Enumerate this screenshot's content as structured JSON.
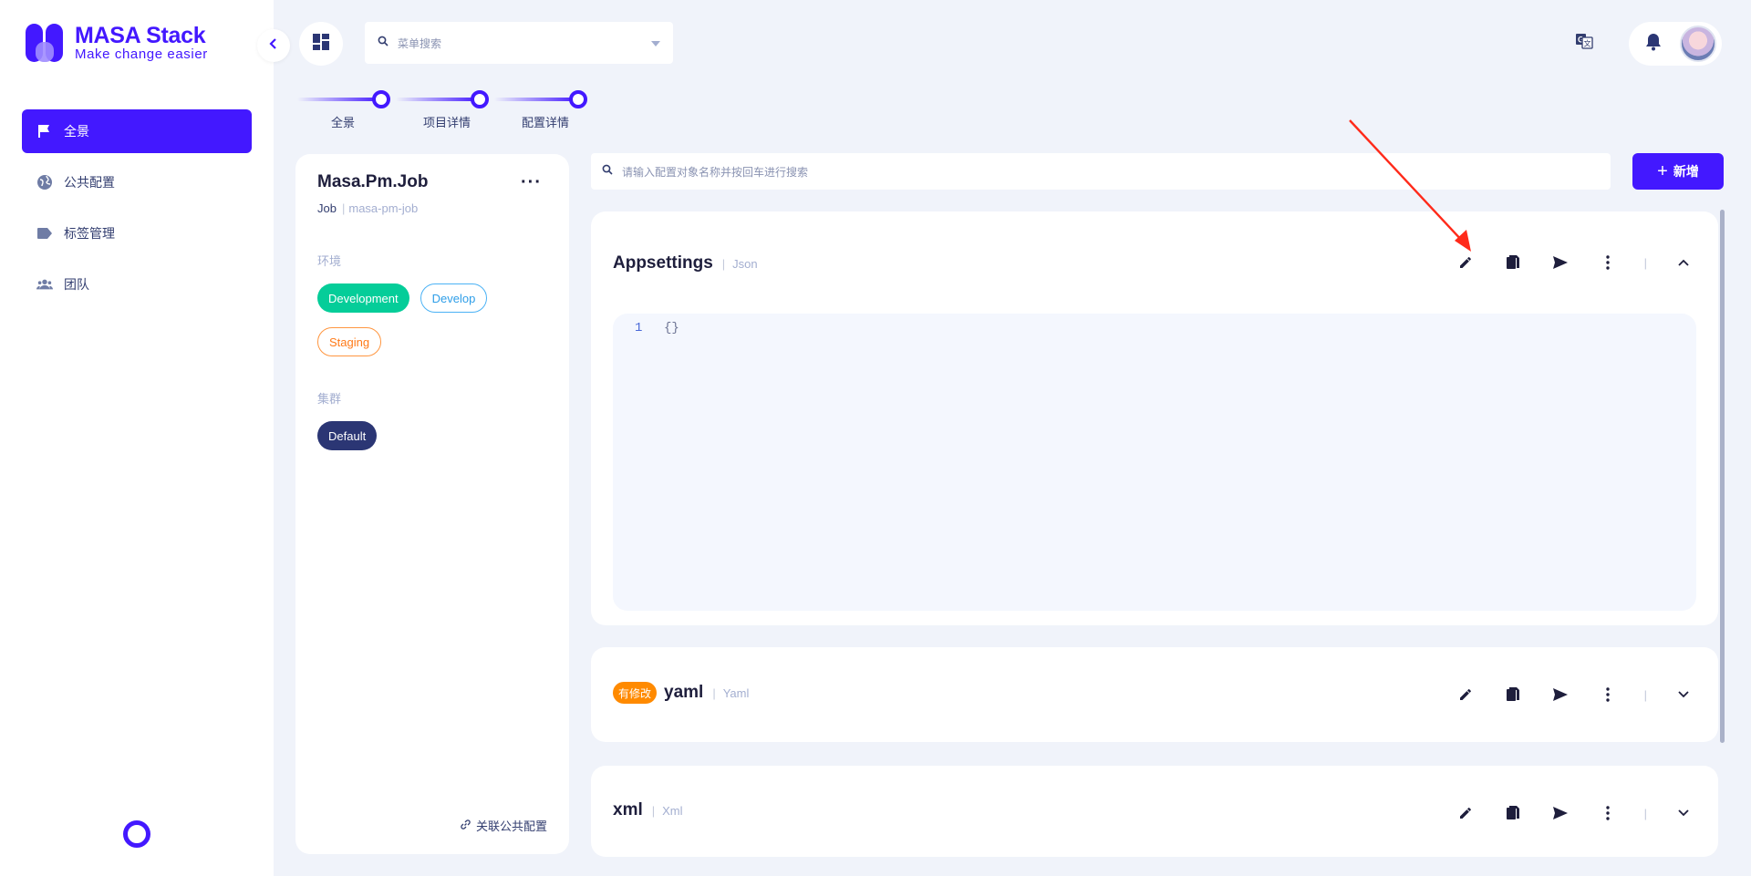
{
  "app": {
    "logo_title": "MASA Stack",
    "logo_subtitle": "Make change easier",
    "brand_color": "#4318ff"
  },
  "sidebar": {
    "items": [
      {
        "label": "全景",
        "icon": "flag-icon",
        "active": true
      },
      {
        "label": "公共配置",
        "icon": "globe-icon",
        "active": false
      },
      {
        "label": "标签管理",
        "icon": "label-icon",
        "active": false
      },
      {
        "label": "团队",
        "icon": "team-icon",
        "active": false
      }
    ]
  },
  "header": {
    "menu_search_placeholder": "菜单搜索"
  },
  "steps": [
    {
      "label": "全景"
    },
    {
      "label": "项目详情"
    },
    {
      "label": "配置详情"
    }
  ],
  "project": {
    "title": "Masa.Pm.Job",
    "type": "Job",
    "identity": "masa-pm-job",
    "env_label": "环境",
    "environments": [
      "Development",
      "Develop",
      "Staging"
    ],
    "cluster_label": "集群",
    "clusters": [
      "Default"
    ],
    "link_public_label": "关联公共配置"
  },
  "config_search_placeholder": "请输入配置对象名称并按回车进行搜索",
  "add_button_label": "新增",
  "configs": [
    {
      "name": "Appsettings",
      "format": "Json",
      "expanded": true,
      "modified": false,
      "line_numbers": [
        "1"
      ],
      "content": "{}"
    },
    {
      "name": "yaml",
      "format": "Yaml",
      "expanded": false,
      "modified": true,
      "modified_label": "有修改"
    },
    {
      "name": "xml",
      "format": "Xml",
      "expanded": false,
      "modified": false
    }
  ],
  "colors": {
    "development": "#05cd99",
    "develop": "#2e9ee8",
    "staging": "#ff7a18",
    "default": "#2b3674",
    "modified": "#ff8a00",
    "annotation_arrow": "#ff2a1a"
  }
}
